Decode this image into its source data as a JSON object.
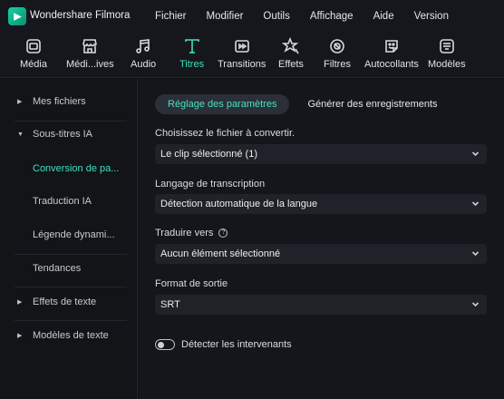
{
  "app": {
    "name": "Wondershare Filmora"
  },
  "menu": [
    "Fichier",
    "Modifier",
    "Outils",
    "Affichage",
    "Aide",
    "Version"
  ],
  "toolbar": [
    {
      "label": "Média",
      "icon": "media-icon"
    },
    {
      "label": "Médi...ives",
      "icon": "stock-media-icon"
    },
    {
      "label": "Audio",
      "icon": "music-note-icon"
    },
    {
      "label": "Titres",
      "icon": "titles-icon",
      "active": true
    },
    {
      "label": "Transitions",
      "icon": "transitions-icon"
    },
    {
      "label": "Effets",
      "icon": "effects-icon"
    },
    {
      "label": "Filtres",
      "icon": "filters-icon"
    },
    {
      "label": "Autocollants",
      "icon": "stickers-icon"
    },
    {
      "label": "Modèles",
      "icon": "templates-icon"
    }
  ],
  "sidebar": {
    "items": [
      {
        "label": "Mes fichiers"
      },
      {
        "label": "Sous-titres IA"
      },
      {
        "label": "Conversion de pa..."
      },
      {
        "label": "Traduction IA"
      },
      {
        "label": "Légende dynami..."
      },
      {
        "label": "Tendances"
      },
      {
        "label": "Effets de texte"
      },
      {
        "label": "Modèles de texte"
      }
    ]
  },
  "main": {
    "tabs": [
      "Réglage des paramètres",
      "Générer des enregistrements"
    ],
    "fields": [
      {
        "label": "Choisissez le fichier à convertir.",
        "value": "Le clip sélectionné (1)"
      },
      {
        "label": "Langage de transcription",
        "value": "Détection automatique de la langue"
      },
      {
        "label": "Traduire vers",
        "value": "Aucun élément sélectionné"
      },
      {
        "label": "Format de sortie",
        "value": "SRT"
      }
    ],
    "toggle": {
      "label": "Détecter les intervenants",
      "on": false
    }
  },
  "colors": {
    "accent": "#3fe0c0",
    "background": "#14161b",
    "titlebar": "#15171c"
  }
}
